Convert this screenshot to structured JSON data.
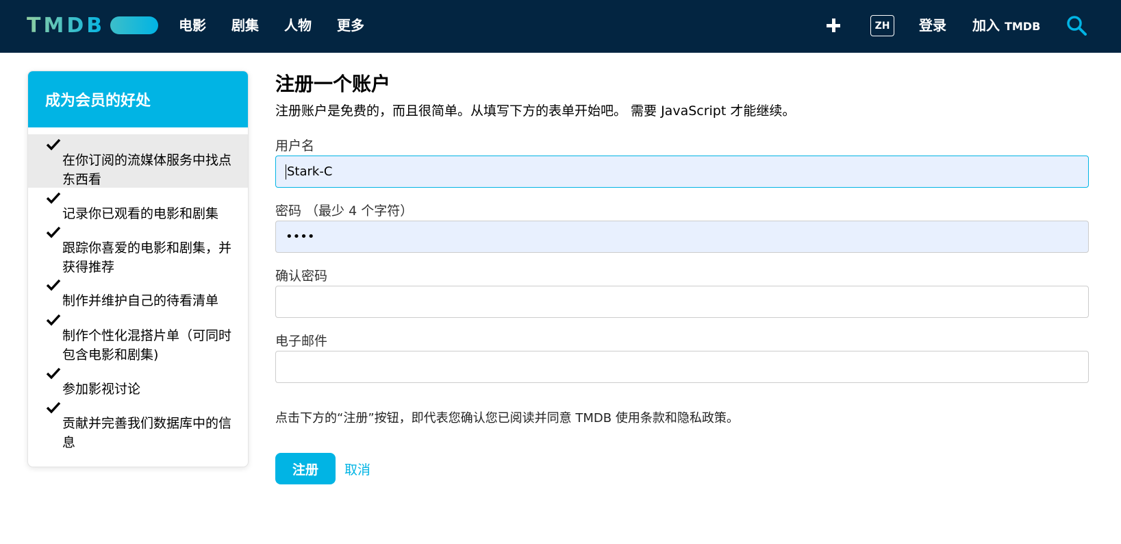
{
  "header": {
    "logo": "TMDB",
    "nav": [
      "电影",
      "剧集",
      "人物",
      "更多"
    ],
    "lang": "ZH",
    "login": "登录",
    "join_prefix": "加入",
    "join_brand": "TMDB"
  },
  "sidebar": {
    "title": "成为会员的好处",
    "items": [
      "在你订阅的流媒体服务中找点东西看",
      "记录你已观看的电影和剧集",
      "跟踪你喜爱的电影和剧集，并获得推荐",
      "制作并维护自己的待看清单",
      "制作个性化混搭片单（可同时包含电影和剧集)",
      "参加影视讨论",
      "贡献并完善我们数据库中的信息"
    ]
  },
  "form": {
    "title": "注册一个账户",
    "intro": "注册账户是免费的，而且很简单。从填写下方的表单开始吧。 需要 JavaScript 才能继续。",
    "username_label": "用户名",
    "username_value": "Stark-C",
    "password_label": "密码 （最少 4 个字符）",
    "password_value": "••••",
    "confirm_label": "确认密码",
    "confirm_value": "",
    "email_label": "电子邮件",
    "email_value": "",
    "terms": "点击下方的“注册”按钮，即代表您确认您已阅读并同意 TMDB 使用条款和隐私政策。",
    "submit": "注册",
    "cancel": "取消"
  },
  "colors": {
    "header_bg": "#032541",
    "accent": "#01b4e4"
  }
}
